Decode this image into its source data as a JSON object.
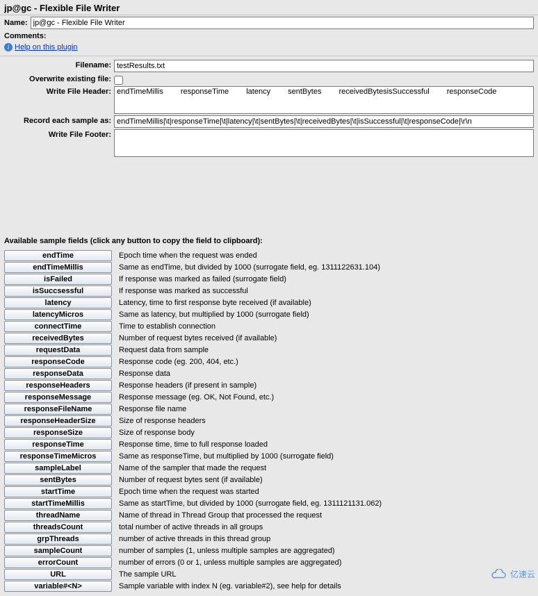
{
  "title": "jp@gc - Flexible File Writer",
  "name_label": "Name:",
  "name_value": "jp@gc - Flexible File Writer",
  "comments_label": "Comments:",
  "help_link": "Help on this plugin",
  "cfg": {
    "filename_label": "Filename:",
    "filename_value": "testResults.txt",
    "overwrite_label": "Overwrite existing file:",
    "overwrite_checked": false,
    "header_label": "Write File Header:",
    "header_value": "endTimeMillis responseTime latency sentBytes receivedBytesisSuccessful responseCode",
    "record_label": "Record each sample as:",
    "record_value": "endTimeMillis|\\t|responseTime|\\t|latency|\\t|sentBytes|\\t|receivedBytes|\\t|isSuccessful|\\t|responseCode|\\r\\n",
    "footer_label": "Write File Footer:",
    "footer_value": ""
  },
  "available_title": "Available sample fields (click any button to copy the field to clipboard):",
  "fields": [
    {
      "name": "endTime",
      "desc": "Epoch time when the request was ended"
    },
    {
      "name": "endTimeMillis",
      "desc": "Same as endTime, but divided by 1000 (surrogate field, eg. 1311122631.104)"
    },
    {
      "name": "isFailed",
      "desc": "If response was marked as failed (surrogate field)"
    },
    {
      "name": "isSuccsessful",
      "desc": "If response was marked as successful"
    },
    {
      "name": "latency",
      "desc": "Latency, time to first response byte received (if available)"
    },
    {
      "name": "latencyMicros",
      "desc": "Same as latency, but multiplied by 1000 (surrogate field)"
    },
    {
      "name": "connectTime",
      "desc": "Time to establish connection"
    },
    {
      "name": "receivedBytes",
      "desc": "Number of request bytes received (if available)"
    },
    {
      "name": "requestData",
      "desc": "Request data from sample"
    },
    {
      "name": "responseCode",
      "desc": "Response code (eg. 200, 404, etc.)"
    },
    {
      "name": "responseData",
      "desc": "Response data"
    },
    {
      "name": "responseHeaders",
      "desc": "Response headers (if present in sample)"
    },
    {
      "name": "responseMessage",
      "desc": "Response message (eg. OK, Not Found, etc.)"
    },
    {
      "name": "responseFileName",
      "desc": "Response file name"
    },
    {
      "name": "responseHeaderSize",
      "desc": "Size of response headers"
    },
    {
      "name": "responseSize",
      "desc": "Size of response body"
    },
    {
      "name": "responseTime",
      "desc": "Response time, time to full response loaded"
    },
    {
      "name": "responseTimeMicros",
      "desc": "Same as responseTime, but multiplied by 1000 (surrogate field)"
    },
    {
      "name": "sampleLabel",
      "desc": "Name of the sampler that made the request"
    },
    {
      "name": "sentBytes",
      "desc": "Number of request bytes sent (if available)"
    },
    {
      "name": "startTime",
      "desc": "Epoch time when the request was started"
    },
    {
      "name": "startTimeMillis",
      "desc": "Same as startTime, but divided by 1000 (surrogate field, eg. 1311121131.062)"
    },
    {
      "name": "threadName",
      "desc": "Name of thread in Thread Group that processed the request"
    },
    {
      "name": "threadsCount",
      "desc": "total number of active threads in all groups"
    },
    {
      "name": "grpThreads",
      "desc": "number of active threads in this thread group"
    },
    {
      "name": "sampleCount",
      "desc": "number of samples (1, unless multiple samples are aggregated)"
    },
    {
      "name": "errorCount",
      "desc": "number of errors (0 or 1, unless multiple samples are aggregated)"
    },
    {
      "name": "URL",
      "desc": "The sample URL"
    },
    {
      "name": "variable#<N>",
      "desc": "Sample variable with index N (eg. variable#2), see help for details"
    }
  ],
  "watermark": "亿速云"
}
